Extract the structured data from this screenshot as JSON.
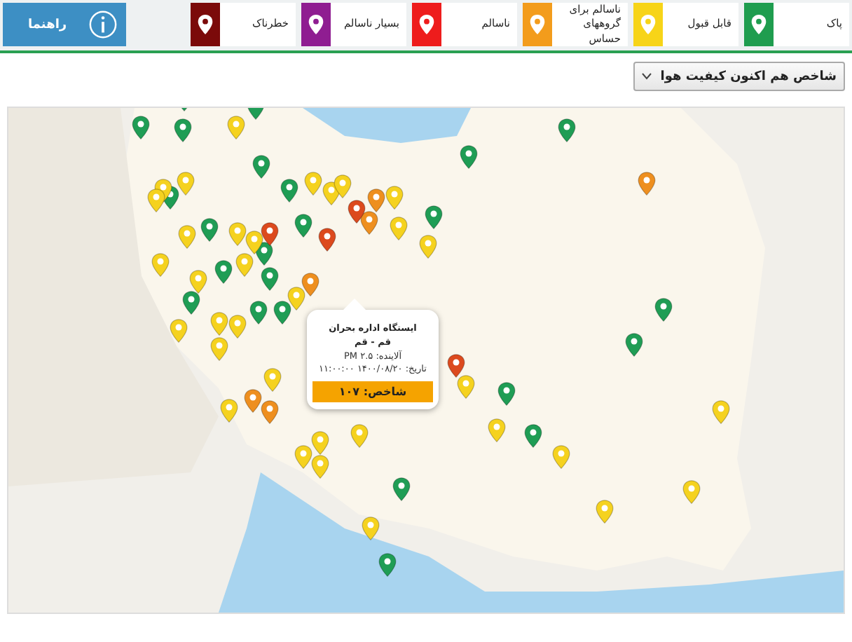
{
  "legend": [
    {
      "label": "پاک",
      "color": "#1f9d4f"
    },
    {
      "label": "قابل قبول",
      "color": "#f7d418"
    },
    {
      "label": "ناسالم برای گروههای حساس",
      "color": "#f39c1c"
    },
    {
      "label": "ناسالم",
      "color": "#ee1c1c"
    },
    {
      "label": "بسیار ناسالم",
      "color": "#8f1d91"
    },
    {
      "label": "خطرناک",
      "color": "#7b0a0a"
    }
  ],
  "help_button": {
    "label": "راهنما"
  },
  "index_select": {
    "value": "شاخص هم اکنون کیفیت هوا"
  },
  "map": {
    "markers": [
      {
        "color": "#1f9d55"
      },
      {
        "color": "#1f9d55"
      },
      {
        "color": "#1f9d55"
      },
      {
        "color": "#1f9d55"
      },
      {
        "color": "#1f9d55"
      },
      {
        "color": "#1f9d55"
      },
      {
        "color": "#1f9d55"
      },
      {
        "color": "#1f9d55"
      },
      {
        "color": "#1f9d55"
      },
      {
        "color": "#1f9d55"
      },
      {
        "color": "#1f9d55"
      },
      {
        "color": "#1f9d55"
      },
      {
        "color": "#1f9d55"
      },
      {
        "color": "#1f9d55"
      },
      {
        "color": "#1f9d55"
      },
      {
        "color": "#1f9d55"
      },
      {
        "color": "#1f9d55"
      },
      {
        "color": "#1f9d55"
      },
      {
        "color": "#1f9d55"
      },
      {
        "color": "#1f9d55"
      },
      {
        "color": "#1f9d55"
      },
      {
        "color": "#1f9d55"
      },
      {
        "color": "#1f9d55"
      },
      {
        "color": "#1f9d55"
      },
      {
        "color": "#f5d21f"
      },
      {
        "color": "#f5d21f"
      },
      {
        "color": "#f5d21f"
      },
      {
        "color": "#f5d21f"
      },
      {
        "color": "#f5d21f"
      },
      {
        "color": "#f5d21f"
      },
      {
        "color": "#f5d21f"
      },
      {
        "color": "#f5d21f"
      },
      {
        "color": "#f5d21f"
      },
      {
        "color": "#f5d21f"
      },
      {
        "color": "#f5d21f"
      },
      {
        "color": "#f5d21f"
      },
      {
        "color": "#f5d21f"
      },
      {
        "color": "#f5d21f"
      },
      {
        "color": "#f5d21f"
      },
      {
        "color": "#f5d21f"
      },
      {
        "color": "#f5d21f"
      },
      {
        "color": "#f5d21f"
      },
      {
        "color": "#f5d21f"
      },
      {
        "color": "#f5d21f"
      },
      {
        "color": "#f5d21f"
      },
      {
        "color": "#f5d21f"
      },
      {
        "color": "#f5d21f"
      },
      {
        "color": "#f5d21f"
      },
      {
        "color": "#f5d21f"
      },
      {
        "color": "#f5d21f"
      },
      {
        "color": "#f5d21f"
      },
      {
        "color": "#f5d21f"
      },
      {
        "color": "#f5d21f"
      },
      {
        "color": "#f5d21f"
      },
      {
        "color": "#f5d21f"
      },
      {
        "color": "#f5d21f"
      },
      {
        "color": "#f5d21f"
      },
      {
        "color": "#f5d21f"
      },
      {
        "color": "#ee8f1f"
      },
      {
        "color": "#ee8f1f"
      },
      {
        "color": "#ee8f1f"
      },
      {
        "color": "#ee8f1f"
      },
      {
        "color": "#ee8f1f"
      },
      {
        "color": "#ee8f1f"
      },
      {
        "color": "#dc4a1e"
      },
      {
        "color": "#dc4a1e"
      },
      {
        "color": "#dc4a1e"
      },
      {
        "color": "#dc4a1e"
      }
    ],
    "popup": {
      "station": "ایستگاه اداره بحران",
      "city": "قم - قم",
      "pollutant": "آلاینده: PM ۲.۵",
      "date": "تاریخ: ۱۴۰۰/۰۸/۲۰ ۱۱:۰۰:۰۰",
      "index": "شاخص: ۱۰۷",
      "color": "#f5a300"
    }
  }
}
